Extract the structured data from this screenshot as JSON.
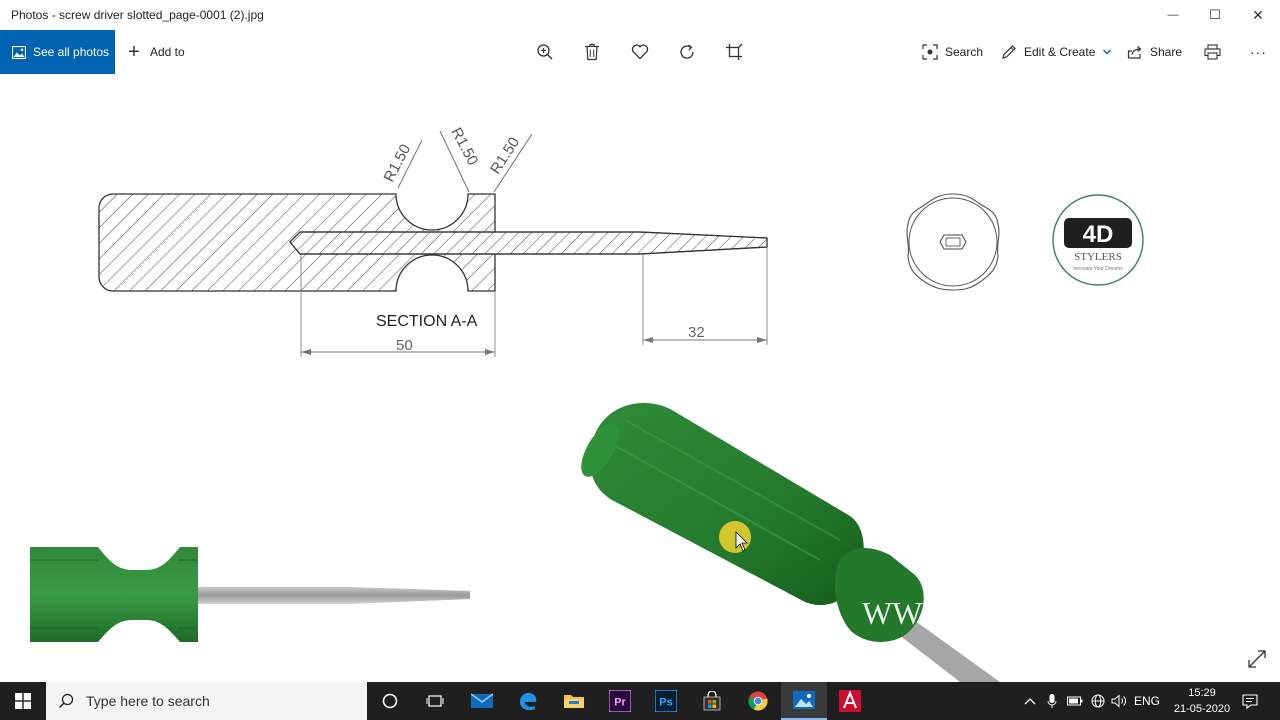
{
  "window": {
    "title": "Photos - screw driver slotted_page-0001 (2).jpg",
    "controls": {
      "minimize": "—",
      "maximize": "☐",
      "close": "✕"
    }
  },
  "toolbar": {
    "see_all_photos": "See all photos",
    "add_to": "Add to",
    "search": "Search",
    "edit_create": "Edit & Create",
    "share": "Share",
    "more": "···",
    "accent": "#0063b1"
  },
  "drawing": {
    "dim_r1": "R1.50",
    "dim_r2": "R1.50",
    "dim_r3": "R1.50",
    "section_label": "SECTION A-A",
    "dim_50": "50",
    "dim_32": "32",
    "logo_main": "4D",
    "logo_text": "STYLERS",
    "logo_tagline": "Innovate Your Dreams",
    "watermark": "WWW",
    "handle_color": "#2e7d32"
  },
  "taskbar": {
    "search_placeholder": "Type here to search",
    "language": "ENG",
    "time": "15:29",
    "date": "21-05-2020",
    "apps": [
      "cortana",
      "task-view",
      "mail",
      "edge",
      "file-explorer",
      "premiere-pro",
      "photoshop",
      "store",
      "chrome",
      "photos",
      "autocad"
    ]
  }
}
